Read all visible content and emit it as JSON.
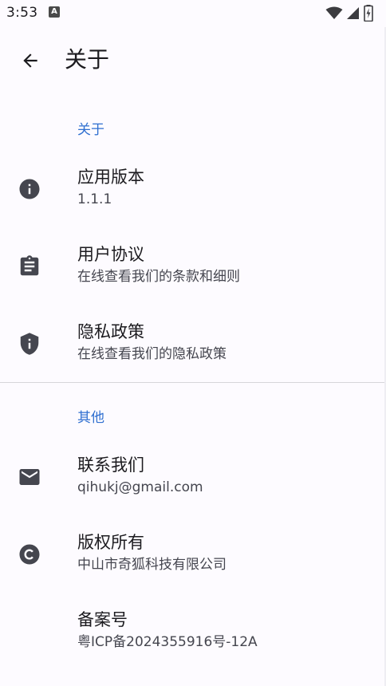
{
  "status_bar": {
    "time": "3:53",
    "app_icon_letter": "A"
  },
  "app_bar": {
    "title": "关于"
  },
  "sections": {
    "about": {
      "header": "关于",
      "items": [
        {
          "title": "应用版本",
          "summary": "1.1.1",
          "icon": "info-icon"
        },
        {
          "title": "用户协议",
          "summary": "在线查看我们的条款和细则",
          "icon": "clipboard-icon"
        },
        {
          "title": "隐私政策",
          "summary": "在线查看我们的隐私政策",
          "icon": "shield-icon"
        }
      ]
    },
    "other": {
      "header": "其他",
      "items": [
        {
          "title": "联系我们",
          "summary": "qihukj@gmail.com",
          "icon": "mail-icon"
        },
        {
          "title": "版权所有",
          "summary": "中山市奇狐科技有限公司",
          "icon": "copyright-icon"
        },
        {
          "title": "备案号",
          "summary": "粤ICP备2024355916号-12A",
          "icon": ""
        }
      ]
    }
  },
  "colors": {
    "accent": "#2f6fd0",
    "background": "#fdfbff",
    "icon": "#45464f"
  }
}
